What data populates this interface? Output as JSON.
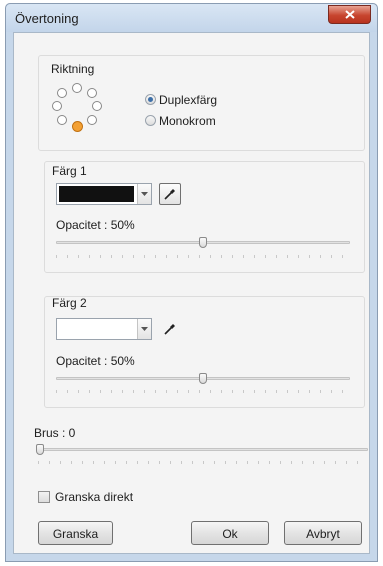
{
  "window": {
    "title": "Övertoning",
    "close_glyph": "✕"
  },
  "direction": {
    "label": "Riktning",
    "options": [
      {
        "label": "Duplexfärg",
        "checked": true
      },
      {
        "label": "Monokrom",
        "checked": false
      }
    ]
  },
  "color1": {
    "label": "Färg 1",
    "swatch": "#111111",
    "opacity_label": "Opacitet : 50%",
    "opacity_value": 0.5
  },
  "color2": {
    "label": "Färg 2",
    "swatch": "#ffffff",
    "opacity_label": "Opacitet : 50%",
    "opacity_value": 0.5
  },
  "noise": {
    "label": "Brus : 0",
    "value": 0
  },
  "preview_live": {
    "label": "Granska direkt",
    "checked": false
  },
  "buttons": {
    "preview": "Granska",
    "ok": "Ok",
    "cancel": "Avbryt"
  },
  "colors": {
    "selected_direction": "#f3a033",
    "radio_dot": "#3d6fa8",
    "close_button": "#c7452f"
  }
}
